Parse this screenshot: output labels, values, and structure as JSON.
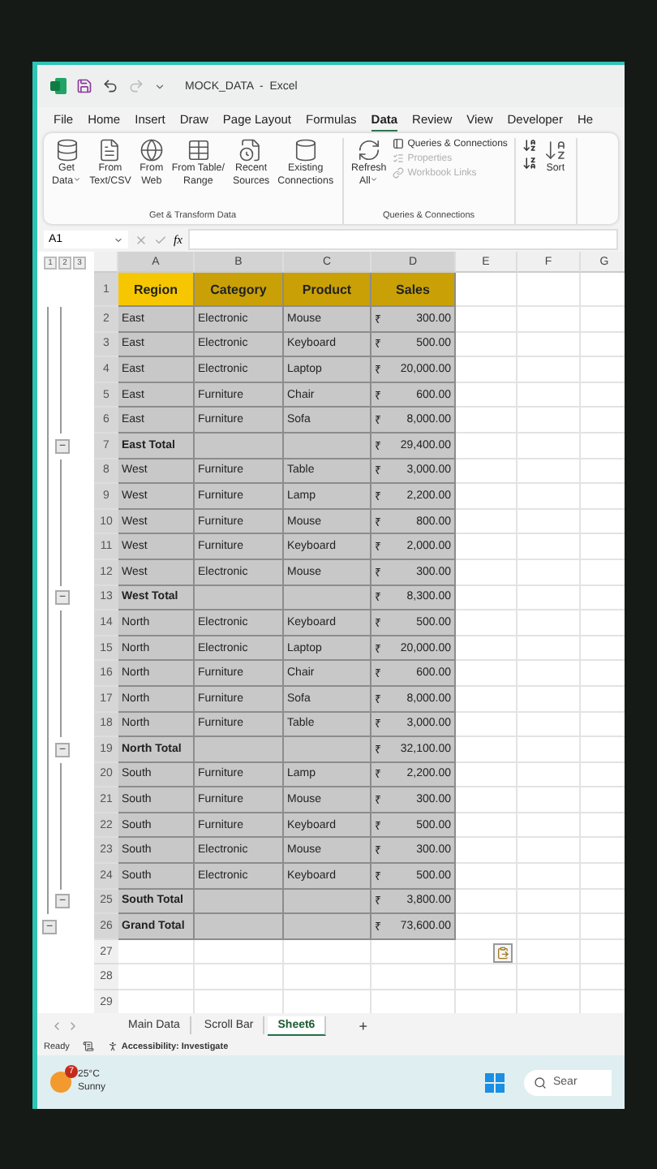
{
  "title_bar": {
    "title": "MOCK_DATA  -  Excel"
  },
  "menu_tabs": [
    {
      "label": "File",
      "selected": false
    },
    {
      "label": "Home",
      "selected": false
    },
    {
      "label": "Insert",
      "selected": false
    },
    {
      "label": "Draw",
      "selected": false
    },
    {
      "label": "Page Layout",
      "selected": false
    },
    {
      "label": "Formulas",
      "selected": false
    },
    {
      "label": "Data",
      "selected": true
    },
    {
      "label": "Review",
      "selected": false
    },
    {
      "label": "View",
      "selected": false
    },
    {
      "label": "Developer",
      "selected": false
    },
    {
      "label": "He",
      "selected": false
    }
  ],
  "ribbon": {
    "groups": [
      {
        "label": "Get & Transform Data",
        "buttons": [
          {
            "lines": [
              "Get",
              "Data"
            ],
            "dropdown": true
          },
          {
            "lines": [
              "From",
              "Text/CSV"
            ],
            "dropdown": false
          },
          {
            "lines": [
              "From",
              "Web"
            ],
            "dropdown": false
          },
          {
            "lines": [
              "From Table/",
              "Range"
            ],
            "dropdown": false
          },
          {
            "lines": [
              "Recent",
              "Sources"
            ],
            "dropdown": false
          },
          {
            "lines": [
              "Existing",
              "Connections"
            ],
            "dropdown": false
          }
        ]
      },
      {
        "label": "Queries & Connections",
        "buttons": [
          {
            "lines": [
              "Refresh",
              "All"
            ],
            "dropdown": true
          }
        ],
        "small": [
          {
            "label": "Queries & Connections",
            "disabled": false
          },
          {
            "label": "Properties",
            "disabled": true
          },
          {
            "label": "Workbook Links",
            "disabled": true
          }
        ]
      }
    ],
    "sort": {
      "label": "Sort"
    }
  },
  "formula_bar": {
    "name_box": "A1",
    "fx": "fx"
  },
  "sheet": {
    "outline_levels": [
      "1",
      "2",
      "3"
    ],
    "columns": [
      "A",
      "B",
      "C",
      "D",
      "E",
      "F",
      "G"
    ],
    "rows": [
      {
        "number": "1",
        "kind": "header",
        "cells": [
          {
            "text": "Region",
            "selected": true
          },
          {
            "text": "Category",
            "selected": false
          },
          {
            "text": "Product",
            "selected": false
          },
          {
            "text": "Sales",
            "selected": false
          }
        ]
      },
      {
        "number": "2",
        "kind": "data",
        "cells": [
          "East",
          "Electronic",
          "Mouse"
        ],
        "currency": "₹",
        "amount": "300.00"
      },
      {
        "number": "3",
        "kind": "data",
        "cells": [
          "East",
          "Electronic",
          "Keyboard"
        ],
        "currency": "₹",
        "amount": "500.00"
      },
      {
        "number": "4",
        "kind": "data",
        "cells": [
          "East",
          "Electronic",
          "Laptop"
        ],
        "currency": "₹",
        "amount": "20,000.00"
      },
      {
        "number": "5",
        "kind": "data",
        "cells": [
          "East",
          "Furniture",
          "Chair"
        ],
        "currency": "₹",
        "amount": "600.00"
      },
      {
        "number": "6",
        "kind": "data",
        "cells": [
          "East",
          "Furniture",
          "Sofa"
        ],
        "currency": "₹",
        "amount": "8,000.00"
      },
      {
        "number": "7",
        "kind": "total",
        "cells": [
          "East Total",
          "",
          ""
        ],
        "currency": "₹",
        "amount": "29,400.00",
        "outline_button": "−"
      },
      {
        "number": "8",
        "kind": "data",
        "cells": [
          "West",
          "Furniture",
          "Table"
        ],
        "currency": "₹",
        "amount": "3,000.00"
      },
      {
        "number": "9",
        "kind": "data",
        "cells": [
          "West",
          "Furniture",
          "Lamp"
        ],
        "currency": "₹",
        "amount": "2,200.00"
      },
      {
        "number": "10",
        "kind": "data",
        "cells": [
          "West",
          "Furniture",
          "Mouse"
        ],
        "currency": "₹",
        "amount": "800.00"
      },
      {
        "number": "11",
        "kind": "data",
        "cells": [
          "West",
          "Furniture",
          "Keyboard"
        ],
        "currency": "₹",
        "amount": "2,000.00"
      },
      {
        "number": "12",
        "kind": "data",
        "cells": [
          "West",
          "Electronic",
          "Mouse"
        ],
        "currency": "₹",
        "amount": "300.00"
      },
      {
        "number": "13",
        "kind": "total",
        "cells": [
          "West Total",
          "",
          ""
        ],
        "currency": "₹",
        "amount": "8,300.00",
        "outline_button": "−"
      },
      {
        "number": "14",
        "kind": "data",
        "cells": [
          "North",
          "Electronic",
          "Keyboard"
        ],
        "currency": "₹",
        "amount": "500.00"
      },
      {
        "number": "15",
        "kind": "data",
        "cells": [
          "North",
          "Electronic",
          "Laptop"
        ],
        "currency": "₹",
        "amount": "20,000.00"
      },
      {
        "number": "16",
        "kind": "data",
        "cells": [
          "North",
          "Furniture",
          "Chair"
        ],
        "currency": "₹",
        "amount": "600.00"
      },
      {
        "number": "17",
        "kind": "data",
        "cells": [
          "North",
          "Furniture",
          "Sofa"
        ],
        "currency": "₹",
        "amount": "8,000.00"
      },
      {
        "number": "18",
        "kind": "data",
        "cells": [
          "North",
          "Furniture",
          "Table"
        ],
        "currency": "₹",
        "amount": "3,000.00"
      },
      {
        "number": "19",
        "kind": "total",
        "cells": [
          "North Total",
          "",
          ""
        ],
        "currency": "₹",
        "amount": "32,100.00",
        "outline_button": "−"
      },
      {
        "number": "20",
        "kind": "data",
        "cells": [
          "South",
          "Furniture",
          "Lamp"
        ],
        "currency": "₹",
        "amount": "2,200.00"
      },
      {
        "number": "21",
        "kind": "data",
        "cells": [
          "South",
          "Furniture",
          "Mouse"
        ],
        "currency": "₹",
        "amount": "300.00"
      },
      {
        "number": "22",
        "kind": "data",
        "cells": [
          "South",
          "Furniture",
          "Keyboard"
        ],
        "currency": "₹",
        "amount": "500.00"
      },
      {
        "number": "23",
        "kind": "data",
        "cells": [
          "South",
          "Electronic",
          "Mouse"
        ],
        "currency": "₹",
        "amount": "300.00"
      },
      {
        "number": "24",
        "kind": "data",
        "cells": [
          "South",
          "Electronic",
          "Keyboard"
        ],
        "currency": "₹",
        "amount": "500.00"
      },
      {
        "number": "25",
        "kind": "total",
        "cells": [
          "South Total",
          "",
          ""
        ],
        "currency": "₹",
        "amount": "3,800.00",
        "outline_button": "−"
      },
      {
        "number": "26",
        "kind": "grand",
        "cells": [
          "Grand Total",
          "",
          ""
        ],
        "currency": "₹",
        "amount": "73,600.00",
        "outline_button": "−"
      },
      {
        "number": "27",
        "kind": "empty",
        "paste_options": true
      },
      {
        "number": "28",
        "kind": "empty"
      },
      {
        "number": "29",
        "kind": "empty"
      }
    ]
  },
  "sheet_tabs": [
    {
      "label": "Main Data",
      "selected": false
    },
    {
      "label": "Scroll Bar",
      "selected": false
    },
    {
      "label": "Sheet6",
      "selected": true
    }
  ],
  "add_sheet": "+",
  "status_bar": {
    "mode": "Ready",
    "accessibility": "Accessibility: Investigate"
  },
  "taskbar": {
    "badge": "7",
    "temperature": "25°C",
    "condition": "Sunny",
    "search": "Sear"
  }
}
